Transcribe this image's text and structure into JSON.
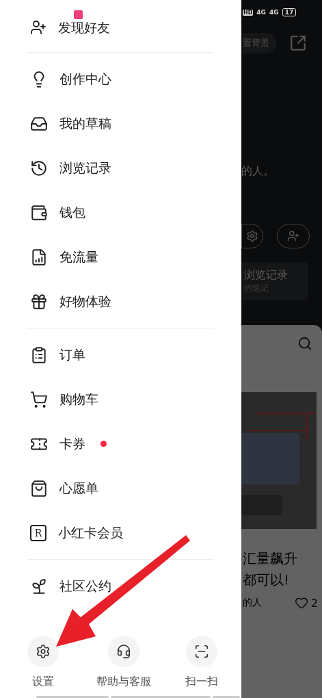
{
  "status_bar": {
    "hd": "HD",
    "network_1": "4G",
    "network_2": "4G",
    "battery": "17"
  },
  "drawer": {
    "top_item": {
      "label": "发现好友"
    },
    "sections": [
      {
        "items": [
          {
            "label": "创作中心",
            "badge": false
          },
          {
            "label": "我的草稿",
            "badge": false
          },
          {
            "label": "浏览记录",
            "badge": false
          },
          {
            "label": "钱包",
            "badge": false
          },
          {
            "label": "免流量",
            "badge": false
          },
          {
            "label": "好物体验",
            "badge": false
          }
        ]
      },
      {
        "items": [
          {
            "label": "订单",
            "badge": false
          },
          {
            "label": "购物车",
            "badge": false
          },
          {
            "label": "卡券",
            "badge": true
          },
          {
            "label": "心愿单",
            "badge": false
          },
          {
            "label": "小红卡会员",
            "badge": false,
            "icon_text": "R"
          }
        ]
      },
      {
        "items": [
          {
            "label": "社区公约",
            "badge": false
          }
        ]
      }
    ],
    "bottom_actions": [
      {
        "label": "设置"
      },
      {
        "label": "帮助与客服"
      },
      {
        "label": "扫一扫"
      }
    ]
  },
  "background_page": {
    "background_button": "置背景",
    "bio": "的人。",
    "history_card": {
      "title": "浏览记录",
      "subtitle": "的笔记"
    },
    "note": {
      "title_lines": [
        "汇量飙升",
        "都可以!"
      ],
      "author": "的人",
      "likes": "2"
    }
  }
}
